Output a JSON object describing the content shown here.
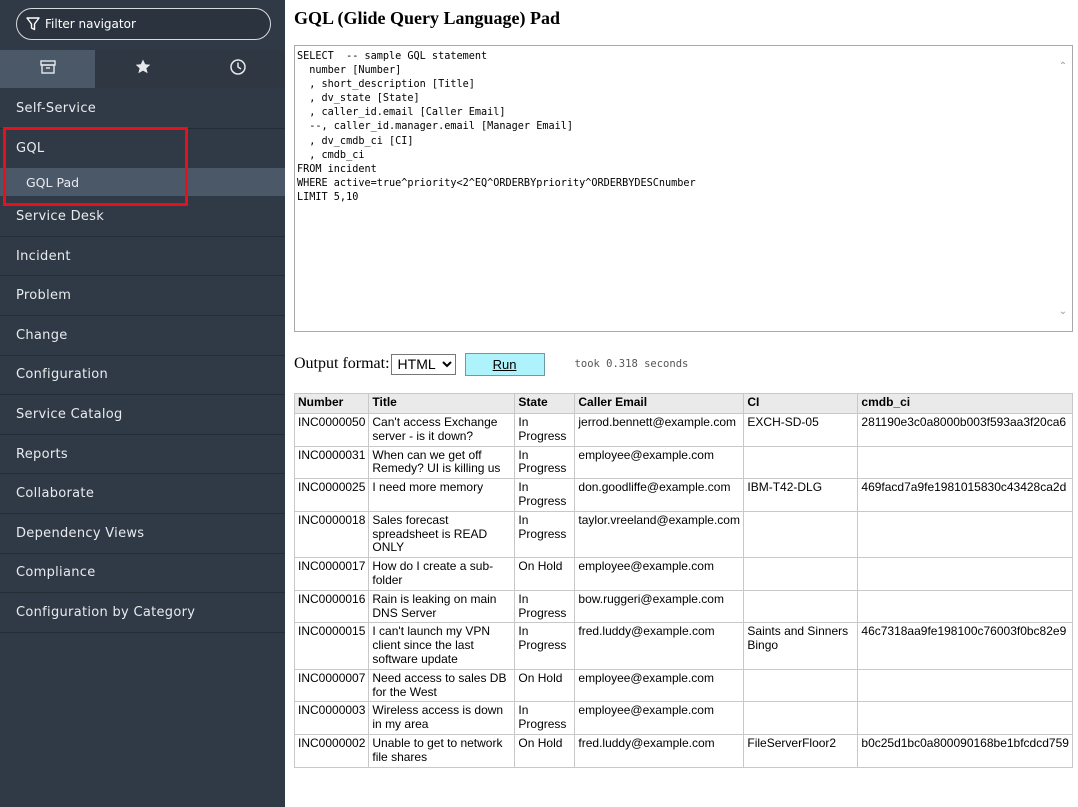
{
  "sidebar": {
    "filter_placeholder": "Filter navigator",
    "tabs": [
      {
        "name": "all-apps",
        "icon": "archive-icon"
      },
      {
        "name": "favorites",
        "icon": "star-icon"
      },
      {
        "name": "history",
        "icon": "clock-icon"
      }
    ],
    "items": {
      "self_service": "Self-Service",
      "gql": "GQL",
      "gql_pad": "GQL Pad",
      "service_desk": "Service Desk",
      "incident": "Incident",
      "problem": "Problem",
      "change": "Change",
      "configuration": "Configuration",
      "service_catalog": "Service Catalog",
      "reports": "Reports",
      "collaborate": "Collaborate",
      "dependency_views": "Dependency Views",
      "compliance": "Compliance",
      "configuration_by_category": "Configuration by Category"
    },
    "highlight_color": "#e8111b"
  },
  "main": {
    "title": "GQL (Glide Query Language) Pad",
    "query": "SELECT  -- sample GQL statement\n  number [Number]\n  , short_description [Title]\n  , dv_state [State]\n  , caller_id.email [Caller Email]\n  --, caller_id.manager.email [Manager Email]\n  , dv_cmdb_ci [CI]\n  , cmdb_ci\nFROM incident\nWHERE active=true^priority<2^EQ^ORDERBYpriority^ORDERBYDESCnumber\nLIMIT 5,10",
    "output_format_label": "Output format:",
    "output_format_value": "HTML",
    "run_label": "Run",
    "timing": "took 0.318 seconds",
    "run_button_color": "#aef2fb"
  },
  "table": {
    "headers": [
      "Number",
      "Title",
      "State",
      "Caller Email",
      "CI",
      "cmdb_ci"
    ],
    "rows": [
      [
        "INC0000050",
        "Can't access Exchange server - is it down?",
        "In Progress",
        "jerrod.bennett@example.com",
        "EXCH-SD-05",
        "281190e3c0a8000b003f593aa3f20ca6"
      ],
      [
        "INC0000031",
        "When can we get off Remedy? UI is killing us",
        "In Progress",
        "employee@example.com",
        "",
        ""
      ],
      [
        "INC0000025",
        "I need more memory",
        "In Progress",
        "don.goodliffe@example.com",
        "IBM-T42-DLG",
        "469facd7a9fe1981015830c43428ca2d"
      ],
      [
        "INC0000018",
        "Sales forecast spreadsheet is READ ONLY",
        "In Progress",
        "taylor.vreeland@example.com",
        "",
        ""
      ],
      [
        "INC0000017",
        "How do I create a sub-folder",
        "On Hold",
        "employee@example.com",
        "",
        ""
      ],
      [
        "INC0000016",
        "Rain is leaking on main DNS Server",
        "In Progress",
        "bow.ruggeri@example.com",
        "",
        ""
      ],
      [
        "INC0000015",
        "I can't launch my VPN client since the last software update",
        "In Progress",
        "fred.luddy@example.com",
        "Saints and Sinners Bingo",
        "46c7318aa9fe198100c76003f0bc82e9"
      ],
      [
        "INC0000007",
        "Need access to sales DB for the West",
        "On Hold",
        "employee@example.com",
        "",
        ""
      ],
      [
        "INC0000003",
        "Wireless access is down in my area",
        "In Progress",
        "employee@example.com",
        "",
        ""
      ],
      [
        "INC0000002",
        "Unable to get to network file shares",
        "On Hold",
        "fred.luddy@example.com",
        "FileServerFloor2",
        "b0c25d1bc0a800090168be1bfcdcd759"
      ]
    ]
  }
}
